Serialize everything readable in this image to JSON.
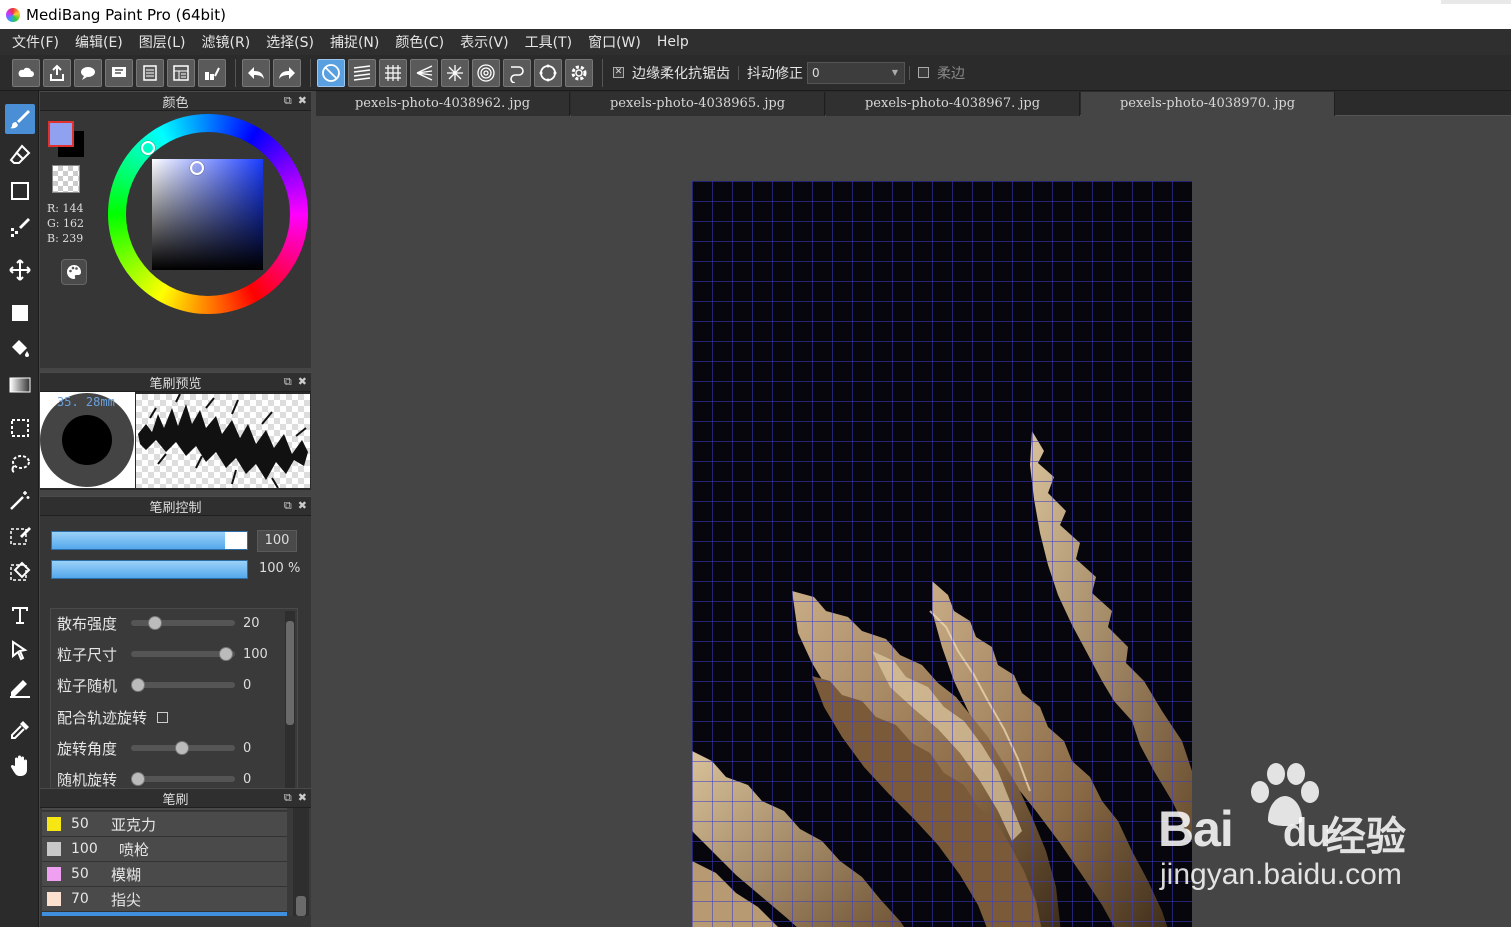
{
  "window": {
    "title": "MediBang Paint Pro (64bit)"
  },
  "menu": [
    "文件(F)",
    "编辑(E)",
    "图层(L)",
    "滤镜(R)",
    "选择(S)",
    "捕捉(N)",
    "颜色(C)",
    "表示(V)",
    "工具(T)",
    "窗口(W)",
    "Help"
  ],
  "toolbar": {
    "antialias_label": "边缘柔化抗锯齿",
    "stabilizer_label": "抖动修正",
    "stabilizer_value": "0",
    "soft_edge_label": "柔边",
    "icons": [
      "cloud-icon",
      "share-icon",
      "comment-icon",
      "chat-icon",
      "page-icon",
      "layout-icon",
      "edit-icon",
      "undo-icon",
      "redo-icon",
      "snap-off-icon",
      "parallel-snap-icon",
      "grid-snap-icon",
      "vanishing-snap-icon",
      "radial-snap-icon",
      "concentric-snap-icon",
      "curve-snap-icon",
      "circle-snap-icon",
      "snap-settings-icon"
    ]
  },
  "tools": [
    "brush-icon",
    "eraser-icon",
    "shape-icon",
    "dot-icon",
    "move-icon",
    "fill-rect-icon",
    "bucket-icon",
    "gradient-icon",
    "rect-select-icon",
    "lasso-icon",
    "magic-wand-icon",
    "select-pen-icon",
    "select-eraser-icon",
    "text-icon",
    "operation-icon",
    "divide-icon",
    "eyedropper-icon",
    "hand-icon"
  ],
  "color_panel": {
    "title": "颜色",
    "fg_color": "#90a2ef",
    "bg_color": "#000000",
    "r_label": "R: 144",
    "g_label": "G: 162",
    "b_label": "B: 239"
  },
  "brush_preview": {
    "title": "笔刷预览",
    "size": "35. 28mm"
  },
  "brush_control": {
    "title": "笔刷控制",
    "size_value": "100",
    "opacity_value": "100 %",
    "params": [
      {
        "label": "散布强度",
        "value": "20",
        "fraction": 0.2
      },
      {
        "label": "粒子尺寸",
        "value": "100",
        "fraction": 1.0
      },
      {
        "label": "粒子随机",
        "value": "0",
        "fraction": 0.0
      },
      {
        "label": "配合轨迹旋转",
        "checkbox": true
      },
      {
        "label": "旋转角度",
        "value": "0",
        "fraction": 0.5
      },
      {
        "label": "随机旋转",
        "value": "0",
        "fraction": 0.0
      }
    ]
  },
  "brush_list": {
    "title": "笔刷",
    "items": [
      {
        "size": "50",
        "name": "亚克力",
        "color": "#f5e614"
      },
      {
        "size": "100",
        "name": "喷枪",
        "color": "#c8c8c8"
      },
      {
        "size": "50",
        "name": "模糊",
        "color": "#f0a0f0"
      },
      {
        "size": "70",
        "name": "指尖",
        "color": "#fbe0d0"
      }
    ]
  },
  "tabs": [
    "pexels-photo-4038962. jpg",
    "pexels-photo-4038965. jpg",
    "pexels-photo-4038967. jpg",
    "pexels-photo-4038970. jpg"
  ],
  "watermark": {
    "brand": "Bai",
    "brand2": "du",
    "cn": "经验",
    "url": "jingyan.baidu.com"
  }
}
